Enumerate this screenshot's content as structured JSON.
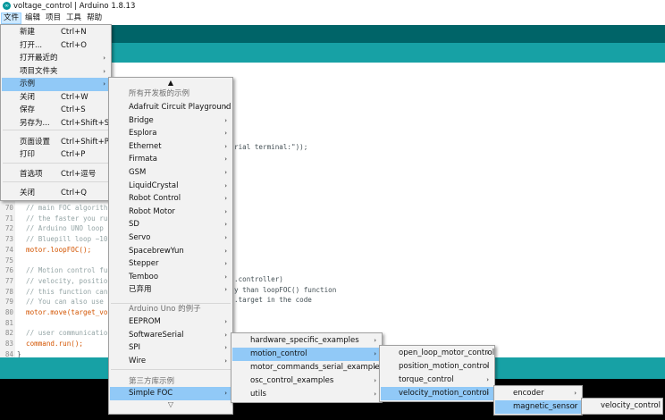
{
  "window": {
    "title": "voltage_control | Arduino 1.8.13"
  },
  "menubar": [
    "文件",
    "编辑",
    "项目",
    "工具",
    "帮助"
  ],
  "editor": {
    "lines": [
      {
        "n": "70",
        "text": "// main FOC algorith",
        "kind": "cm"
      },
      {
        "n": "71",
        "text": "// the faster you ru",
        "kind": "cm"
      },
      {
        "n": "72",
        "text": "// Arduino UNO loop",
        "kind": "cm"
      },
      {
        "n": "73",
        "text": "// Bluepill loop ~10",
        "kind": "cm"
      },
      {
        "n": "74",
        "text": "motor.loopFOC();",
        "kind": "fn"
      },
      {
        "n": "75",
        "text": "",
        "kind": "cm"
      },
      {
        "n": "76",
        "text": "// Motion control fu",
        "kind": "cm"
      },
      {
        "n": "77",
        "text": "// velocity, positio",
        "kind": "cm"
      },
      {
        "n": "78",
        "text": "// this function can",
        "kind": "cm"
      },
      {
        "n": "79",
        "text": "// You can also use",
        "kind": "cm"
      },
      {
        "n": "80",
        "text": "motor.move(target_vo",
        "kind": "fn"
      },
      {
        "n": "81",
        "text": "",
        "kind": "cm"
      },
      {
        "n": "82",
        "text": "// user communicatio",
        "kind": "cm"
      },
      {
        "n": "83",
        "text": "command.run();",
        "kind": "fn"
      },
      {
        "n": "84",
        "text": "}",
        "kind": "pl"
      }
    ],
    "fragments": {
      "top": "rial terminal:\"));",
      "f77": ".controller)",
      "f78": "y than loopFOC() function",
      "f79": ".target in the code"
    }
  },
  "file_menu": [
    {
      "label": "新建",
      "shortcut": "Ctrl+N"
    },
    {
      "label": "打开...",
      "shortcut": "Ctrl+O"
    },
    {
      "label": "打开最近的",
      "arrow": true
    },
    {
      "label": "项目文件夹",
      "arrow": true
    },
    {
      "label": "示例",
      "arrow": true,
      "active": true
    },
    {
      "label": "关闭",
      "shortcut": "Ctrl+W"
    },
    {
      "label": "保存",
      "shortcut": "Ctrl+S"
    },
    {
      "label": "另存为...",
      "shortcut": "Ctrl+Shift+S"
    },
    {
      "label": "页面设置",
      "shortcut": "Ctrl+Shift+P"
    },
    {
      "label": "打印",
      "shortcut": "Ctrl+P"
    },
    {
      "label": "首选项",
      "shortcut": "Ctrl+逗号"
    },
    {
      "label": "关闭",
      "shortcut": "Ctrl+Q"
    }
  ],
  "examples_menu": {
    "scroll_up": "▲",
    "scroll_down": "▽",
    "header_all": "所有开发板的示例",
    "all": [
      "Adafruit Circuit Playground",
      "Bridge",
      "Esplora",
      "Ethernet",
      "Firmata",
      "GSM",
      "LiquidCrystal",
      "Robot Control",
      "Robot Motor",
      "SD",
      "Servo",
      "SpacebrewYun",
      "Stepper",
      "Temboo",
      "已弃用"
    ],
    "header_board": "Arduino Uno 的例子",
    "board": [
      "EEPROM",
      "SoftwareSerial",
      "SPI",
      "Wire"
    ],
    "header_third": "第三方库示例",
    "third": [
      "Simple FOC"
    ]
  },
  "simplefoc_menu": [
    "hardware_specific_examples",
    "motion_control",
    "motor_commands_serial_examples",
    "osc_control_examples",
    "utils"
  ],
  "motion_menu": [
    "open_loop_motor_control",
    "position_motion_control",
    "torque_control",
    "velocity_motion_control"
  ],
  "velocity_menu": [
    "encoder",
    "magnetic_sensor"
  ],
  "magnetic_menu": [
    "velocity_control"
  ],
  "colors": {
    "toolbar": "#006468",
    "tabbar": "#17a1a5",
    "highlight": "#91c9f7",
    "console": "#000000"
  }
}
